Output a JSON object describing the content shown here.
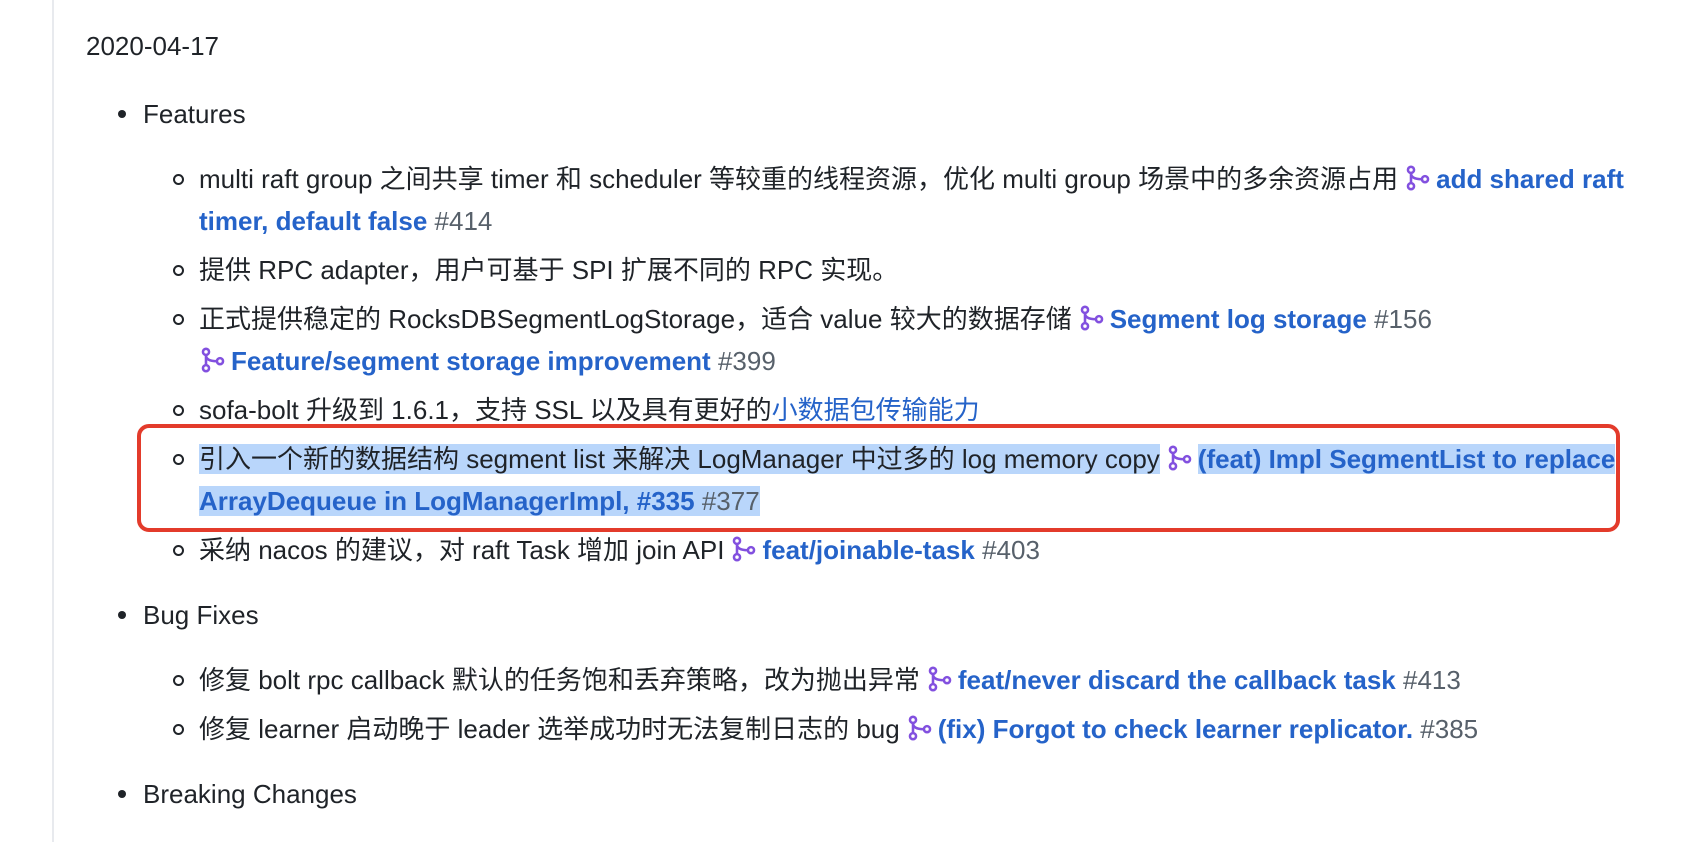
{
  "date": "2020-04-17",
  "sections": {
    "features": {
      "title": "Features",
      "items": [
        {
          "text": "multi raft group 之间共享 timer 和 scheduler 等较重的线程资源，优化 multi group 场景中的多余资源占用",
          "pr_title_1": "add shared raft timer, default false",
          "pr_num_1": "#414"
        },
        {
          "text": "提供 RPC adapter，用户可基于 SPI 扩展不同的 RPC 实现。"
        },
        {
          "text": "正式提供稳定的 RocksDBSegmentLogStorage，适合 value 较大的数据存储",
          "pr_title_1": "Segment log storage",
          "pr_num_1": "#156",
          "pr_title_2": "Feature/segment storage improvement",
          "pr_num_2": "#399"
        },
        {
          "text": "sofa-bolt 升级到 1.6.1，支持 SSL 以及具有更好的",
          "link": "小数据包传输能力"
        },
        {
          "text": "引入一个新的数据结构 segment list 来解决 LogManager 中过多的 log memory copy",
          "pr_title_1": "(feat) Impl SegmentList to replace ArrayDequeue in LogManagerImpl, #335",
          "pr_num_1": "#377"
        },
        {
          "text": "采纳 nacos 的建议，对 raft Task 增加 join API",
          "pr_title_1": "feat/joinable-task",
          "pr_num_1": "#403"
        }
      ]
    },
    "bugfixes": {
      "title": "Bug Fixes",
      "items": [
        {
          "text": "修复 bolt rpc callback 默认的任务饱和丢弃策略，改为抛出异常",
          "pr_title_1": "feat/never discard the callback task",
          "pr_num_1": "#413"
        },
        {
          "text": "修复 learner 启动晚于 leader 选举成功时无法复制日志的 bug",
          "pr_title_1": "(fix) Forgot to check learner replicator.",
          "pr_num_1": "#385"
        }
      ]
    },
    "breaking": {
      "title": "Breaking Changes"
    }
  },
  "icons": {
    "pull_request": "merge-icon",
    "pr_icon_color": "#8250df"
  },
  "colors": {
    "link": "#2563c9",
    "selection": "#b9d6fb",
    "highlight_border": "#e33b2b"
  }
}
